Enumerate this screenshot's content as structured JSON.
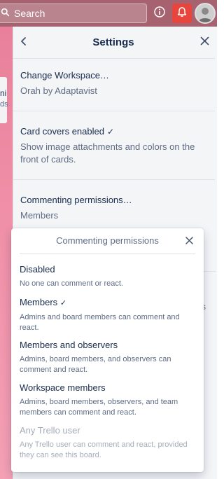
{
  "header": {
    "search_placeholder": "Search",
    "icons": [
      "search-icon",
      "info-icon",
      "bell-icon",
      "avatar"
    ],
    "colors": {
      "topbar": "#a6626f",
      "bell_bg": "#e8453c"
    }
  },
  "board": {
    "card_text": "ni",
    "card_subtext": "ds"
  },
  "panel": {
    "title": "Settings",
    "settings": [
      {
        "title": "Change Workspace…",
        "subtitle": "Orah by Adaptavist"
      },
      {
        "title": "Card covers enabled",
        "checked": true,
        "subtitle": "Show image attachments and colors on the front of cards."
      },
      {
        "title": "Commenting permissions…",
        "subtitle": "Members"
      }
    ],
    "behind_text": "s"
  },
  "popover": {
    "title": "Commenting permissions",
    "options": [
      {
        "label": "Disabled",
        "desc": "No one can comment or react.",
        "selected": false,
        "disabled": false
      },
      {
        "label": "Members",
        "desc": "Admins and board members can comment and react.",
        "selected": true,
        "disabled": false
      },
      {
        "label": "Members and observers",
        "desc": "Admins, board members, and observers can comment and react.",
        "selected": false,
        "disabled": false
      },
      {
        "label": "Workspace members",
        "desc": "Admins, board members, observers, and team members can comment and react.",
        "selected": false,
        "disabled": false
      },
      {
        "label": "Any Trello user",
        "desc": "Any Trello user can comment and react, provided they can see this board.",
        "selected": false,
        "disabled": true
      }
    ]
  }
}
